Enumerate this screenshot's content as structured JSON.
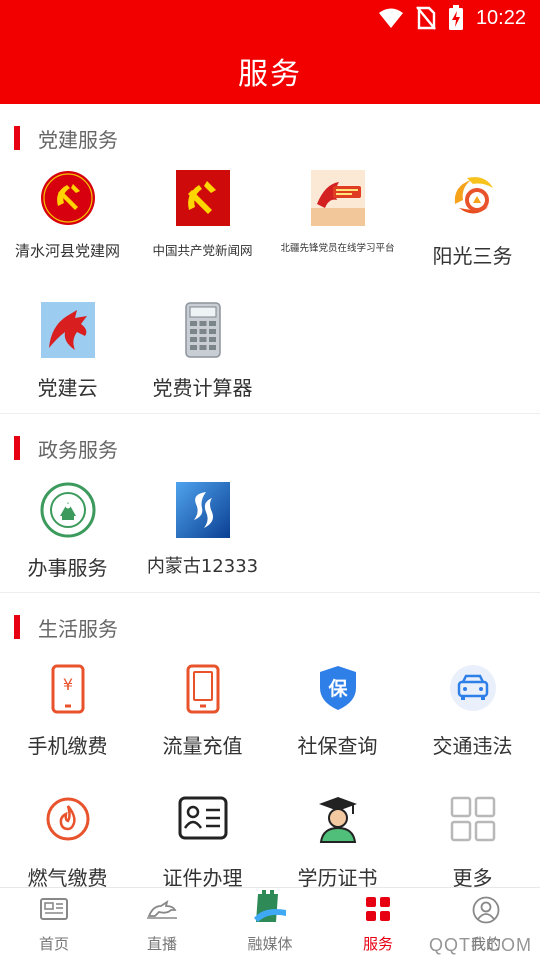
{
  "status_bar": {
    "time": "10:22"
  },
  "header": {
    "title": "服务"
  },
  "sections": {
    "party": {
      "title": "党建服务",
      "items": [
        {
          "label": "清水河县党建网",
          "icon": "party-emblem-circle-icon"
        },
        {
          "label": "中国共产党新闻网",
          "icon": "party-flag-icon"
        },
        {
          "label": "北疆先锋党员在线学习平台",
          "icon": "beijiang-pioneer-icon"
        },
        {
          "label": "阳光三务",
          "icon": "sunshine-logo-icon"
        },
        {
          "label": "党建云",
          "icon": "horse-logo-icon"
        },
        {
          "label": "党费计算器",
          "icon": "calculator-icon"
        }
      ]
    },
    "government": {
      "title": "政务服务",
      "items": [
        {
          "label": "办事服务",
          "icon": "gov-seal-icon"
        },
        {
          "label": "内蒙古12333",
          "icon": "social-security-12333-icon"
        }
      ]
    },
    "life": {
      "title": "生活服务",
      "items": [
        {
          "label": "手机缴费",
          "icon": "phone-payment-icon"
        },
        {
          "label": "流量充值",
          "icon": "data-recharge-icon"
        },
        {
          "label": "社保查询",
          "icon": "social-insurance-shield-icon"
        },
        {
          "label": "交通违法",
          "icon": "traffic-car-icon"
        },
        {
          "label": "燃气缴费",
          "icon": "gas-flame-icon"
        },
        {
          "label": "证件办理",
          "icon": "id-card-icon"
        },
        {
          "label": "学历证书",
          "icon": "graduate-icon"
        },
        {
          "label": "更多",
          "icon": "more-grid-icon"
        }
      ]
    }
  },
  "tabbar": {
    "active": "服务",
    "tabs": [
      {
        "label": "首页",
        "icon": "home-newspaper-icon"
      },
      {
        "label": "直播",
        "icon": "live-horse-icon"
      },
      {
        "label": "融媒体",
        "icon": "media-greatwall-icon"
      },
      {
        "label": "服务",
        "icon": "services-grid-icon"
      },
      {
        "label": "我的",
        "icon": "profile-icon"
      }
    ]
  },
  "watermark": "QQTF.COM",
  "colors": {
    "brand_red": "#f20000",
    "accent_red": "#e60012",
    "icon_orange": "#e8532c",
    "icon_blue": "#2f7fe8"
  }
}
